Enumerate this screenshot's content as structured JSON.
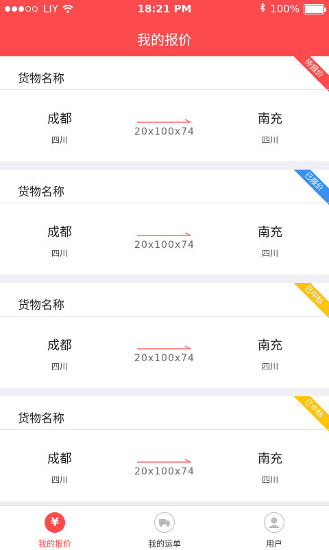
{
  "status_bar": {
    "carrier": "LIY",
    "time": "18:21 PM",
    "battery": "100%"
  },
  "header": {
    "title": "我的报价"
  },
  "colors": {
    "accent": "#fd4a4c",
    "pending": "#fd4a4c",
    "quoted": "#3a8ff3",
    "won": "#ffc20e"
  },
  "cards": [
    {
      "goods": "货物名称",
      "from_city": "成都",
      "from_province": "四川",
      "to_city": "南充",
      "to_province": "四川",
      "dims": "20x100x74",
      "status": "待报价",
      "status_color": "#fd4a4c"
    },
    {
      "goods": "货物名称",
      "from_city": "成都",
      "from_province": "四川",
      "to_city": "南充",
      "to_province": "四川",
      "dims": "20x100x74",
      "status": "已报价",
      "status_color": "#3a8ff3"
    },
    {
      "goods": "货物名称",
      "from_city": "成都",
      "from_province": "四川",
      "to_city": "南充",
      "to_province": "四川",
      "dims": "20x100x74",
      "status": "已中标",
      "status_color": "#ffc20e"
    },
    {
      "goods": "货物名称",
      "from_city": "成都",
      "from_province": "四川",
      "to_city": "南充",
      "to_province": "四川",
      "dims": "20x100x74",
      "status": "已中标",
      "status_color": "#ffc20e"
    }
  ],
  "tabbar": {
    "tabs": [
      {
        "label": "我的报价",
        "icon": "yen-icon",
        "active": true
      },
      {
        "label": "我的运单",
        "icon": "truck-icon",
        "active": false
      },
      {
        "label": "用户",
        "icon": "user-icon",
        "active": false
      }
    ],
    "yen_symbol": "¥"
  }
}
